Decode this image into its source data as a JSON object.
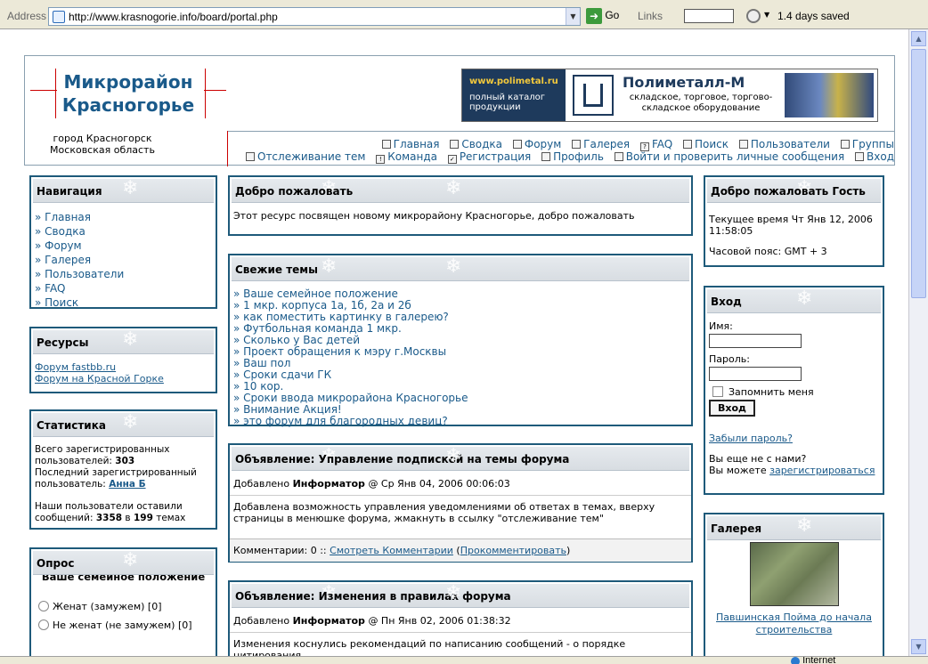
{
  "browser": {
    "address_label": "Address",
    "url": "http://www.krasnogorie.info/board/portal.php",
    "go_label": "Go",
    "links_label": "Links",
    "saved_text": "1.4 days saved",
    "status_zone": "Internet"
  },
  "header": {
    "logo_line1": "Микрорайон",
    "logo_line2": "Красногорье",
    "city_line1": "город Красногорск",
    "city_line2": "Московская область",
    "banner": {
      "url": "www.polimetal.ru",
      "catalog": "полный каталог продукции",
      "title": "Полиметалл-М",
      "subtitle": "складское, торговое, торгово-складское оборудование"
    },
    "nav_row1": [
      "Главная",
      "Сводка",
      "Форум",
      "Галерея",
      "FAQ",
      "Поиск",
      "Пользователи",
      "Группы"
    ],
    "nav_row2": [
      "Отслеживание тем",
      "Команда",
      "Регистрация",
      "Профиль",
      "Войти и проверить личные сообщения",
      "Вход"
    ]
  },
  "navigation": {
    "title": "Навигация",
    "items": [
      "Главная",
      "Сводка",
      "Форум",
      "Галерея",
      "Пользователи",
      "FAQ",
      "Поиск"
    ]
  },
  "resources": {
    "title": "Ресурсы",
    "links": [
      "Форум fastbb.ru",
      "Форум на Красной Горке"
    ]
  },
  "stats": {
    "title": "Статистика",
    "total_users_label": "Всего зарегистрированных пользователей:",
    "total_users": "303",
    "last_user_label": "Последний зарегистрированный пользователь:",
    "last_user": "Анна Б",
    "posts_prefix": "Наши пользователи оставили сообщений:",
    "posts_count": "3358",
    "posts_in": "в",
    "topics_count": "199",
    "posts_suffix": "темах"
  },
  "poll": {
    "title": "Опрос",
    "question": "Ваше семейное положение",
    "options": [
      "Женат (замужем) [0]",
      "Не женат (не замужем) [0]"
    ]
  },
  "welcome": {
    "title": "Добро пожаловать",
    "text": "Этот ресурс посвящен новому микрорайону Красногорье, добро пожаловать"
  },
  "recent": {
    "title": "Свежие темы",
    "topics": [
      "Ваше семейное положение",
      "1 мкр. корпуса 1а, 1б, 2а и 2б",
      "как поместить картинку в галерею?",
      "Футбольная команда 1 мкр.",
      "Сколько у Вас детей",
      "Проект обращения к мэру г.Москвы",
      "Ваш пол",
      "Сроки сдачи ГК",
      "10 кор.",
      "Сроки ввода микрорайона Красногорье",
      "Внимание Акция!",
      "это форум для благородных девиц?"
    ]
  },
  "announce1": {
    "title": "Объявление: Управление подпиской на темы форума",
    "added_label": "Добавлено",
    "author": "Информатор",
    "date": "@ Ср Янв 04, 2006 00:06:03",
    "text": "Добавлена возможность управления уведомлениями об ответах в темах, вверху страницы в менюшке форума, жмакнуть в ссылку \"отслеживание тем\"",
    "comments_prefix": "Комментарии: 0 ::",
    "view_comments": "Смотреть Комментарии",
    "comment": "Прокомментировать"
  },
  "announce2": {
    "title": "Объявление: Изменения в правилах форума",
    "added_label": "Добавлено",
    "author": "Информатор",
    "date": "@ Пн Янв 02, 2006 01:38:32",
    "text": "Изменения коснулись рекомендаций по написанию сообщений - о порядке цитирования."
  },
  "guest": {
    "title": "Добро пожаловать Гость",
    "time_line1": "Текущее время Чт Янв 12, 2006",
    "time_line2": "11:58:05",
    "tz": "Часовой пояс: GMT + 3"
  },
  "login": {
    "title": "Вход",
    "name_label": "Имя:",
    "pass_label": "Пароль:",
    "remember": "Запомнить меня",
    "button": "Вход",
    "forgot": "Забыли пароль?",
    "not_member": "Вы еще не с нами?",
    "can_prefix": "Вы можете",
    "register": "зарегистрироваться"
  },
  "gallery": {
    "title": "Галерея",
    "caption": "Павшинская Пойма до начала строительства"
  }
}
